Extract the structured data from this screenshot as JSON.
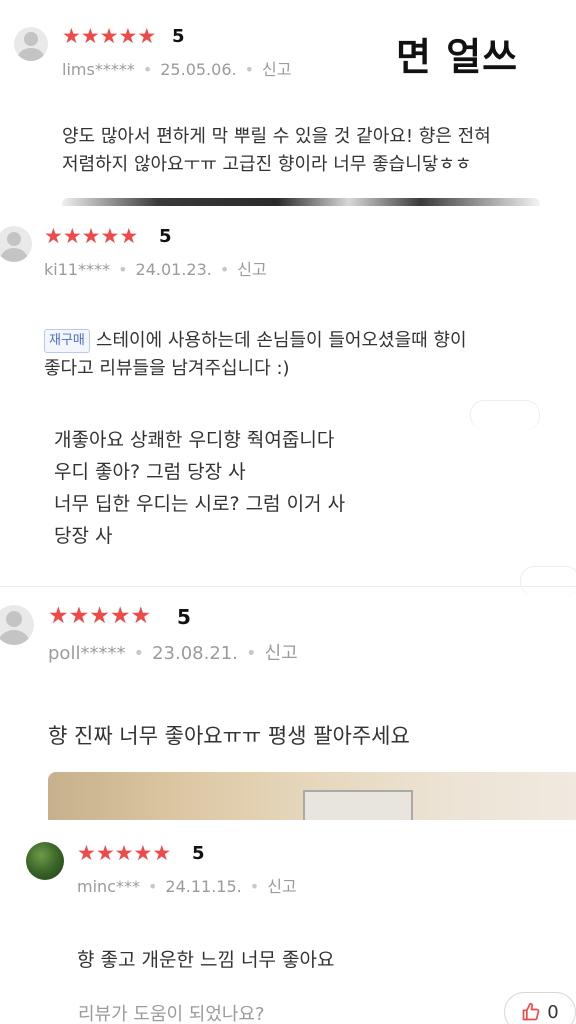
{
  "overlay_title": "면 얼쓰",
  "reviews": [
    {
      "rating": "5",
      "user": "lims*****",
      "date": "25.05.06.",
      "report": "신고",
      "text_lines": [
        "양도 많아서 편하게 막 뿌릴 수 있을 것 같아요! 향은 전혀",
        "저렴하지 않아요ㅜㅠ 고급진 향이라 너무 좋습니닿ㅎㅎ"
      ]
    },
    {
      "rating": "5",
      "user": "ki11****",
      "date": "24.01.23.",
      "report": "신고",
      "badge": "재구매",
      "text_lines": [
        "스테이에 사용하는데 손님들이 들어오셨을때 향이",
        "좋다고 리뷰들을 남겨주십니다 :)"
      ],
      "comment_lines": [
        "개좋아요 상쾌한 우디향 줙여줍니다",
        "우디 좋아? 그럼 당장 사",
        "너무 딥한 우디는 시로? 그럼 이거 사",
        "당장 사"
      ]
    },
    {
      "rating": "5",
      "user": "poll*****",
      "date": "23.08.21.",
      "report": "신고",
      "text_lines": [
        "향 진짜 너무 좋아요ㅠㅠ 평생 팔아주세요"
      ]
    },
    {
      "rating": "5",
      "user": "minc***",
      "date": "24.11.15.",
      "report": "신고",
      "text_lines": [
        "향 좋고 개운한 느낌 너무 좋아요"
      ]
    }
  ],
  "footer": {
    "helpful_question": "리뷰가 도움이 되었나요?",
    "like_count": "0",
    "like_icon": "thumbs-up-icon"
  },
  "colors": {
    "star": "#ef4a4a",
    "meta": "#9b9b9b",
    "badge": "#4a6fd0"
  }
}
